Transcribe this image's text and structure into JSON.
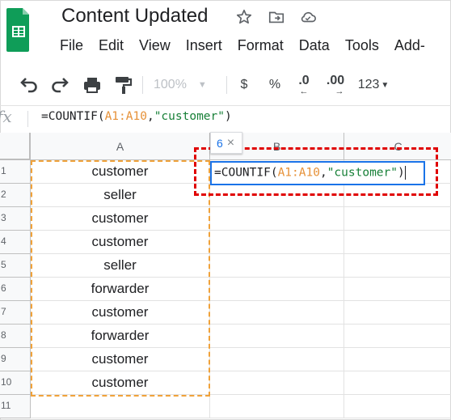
{
  "header": {
    "title": "Content Updated",
    "menu": [
      "File",
      "Edit",
      "View",
      "Insert",
      "Format",
      "Data",
      "Tools",
      "Add-"
    ]
  },
  "toolbar": {
    "zoom": "100%",
    "currency": "$",
    "percent": "%",
    "dec_decrease": ".0",
    "dec_increase": ".00",
    "more_formats": "123"
  },
  "formula_bar": {
    "fx": "fx",
    "prefix": "=COUNTIF(",
    "range": "A1:A10",
    "comma": ",",
    "criterion": "\"customer\"",
    "suffix": ")"
  },
  "grid": {
    "columns": [
      "A",
      "B",
      "C"
    ],
    "rows": [
      "1",
      "2",
      "3",
      "4",
      "5",
      "6",
      "7",
      "8",
      "9",
      "10",
      "11"
    ],
    "column_a": [
      "customer",
      "seller",
      "customer",
      "customer",
      "seller",
      "forwarder",
      "customer",
      "forwarder",
      "customer",
      "customer",
      ""
    ]
  },
  "editor": {
    "prefix": "=COUNTIF(",
    "range": "A1:A10",
    "comma": ",",
    "criterion": "\"customer\"",
    "suffix": ")",
    "tooltip_value": "6",
    "tooltip_close": "×"
  },
  "colors": {
    "accent_blue": "#1a73e8",
    "range_orange": "#e69138",
    "string_green": "#188038",
    "annotation_red": "#e00000",
    "logo_green": "#0f9d58"
  }
}
